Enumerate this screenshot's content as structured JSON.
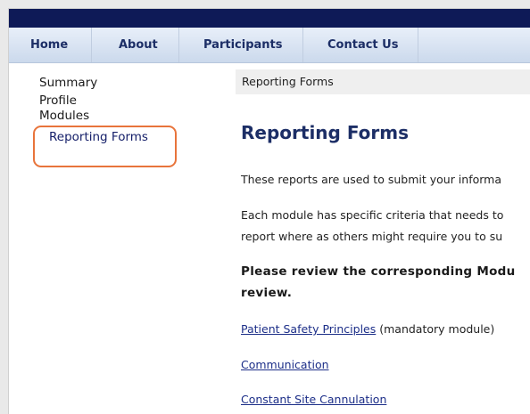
{
  "nav": {
    "home": "Home",
    "about": "About",
    "participants": "Participants",
    "contact": "Contact Us"
  },
  "sidebar": {
    "items": [
      "Summary",
      "Profile",
      "Modules",
      "Reporting Forms"
    ],
    "active": "Reporting Forms"
  },
  "breadcrumb": "Reporting Forms",
  "main": {
    "title": "Reporting Forms",
    "intro": "These reports are used to submit your informa",
    "criteria_line1": "Each module has specific criteria that needs to",
    "criteria_line2": "report where as others might require you to su",
    "review_line1": "Please review the corresponding Modu",
    "review_line2": "review.",
    "links": [
      {
        "label": "Patient Safety Principles",
        "suffix": " (mandatory module)"
      },
      {
        "label": "Communication",
        "suffix": ""
      },
      {
        "label": "Constant Site Cannulation",
        "suffix": ""
      }
    ]
  },
  "colors": {
    "header": "#0e1a57",
    "nav_text": "#1c2e66",
    "highlight": "#e8743b",
    "link": "#1c2e88"
  }
}
